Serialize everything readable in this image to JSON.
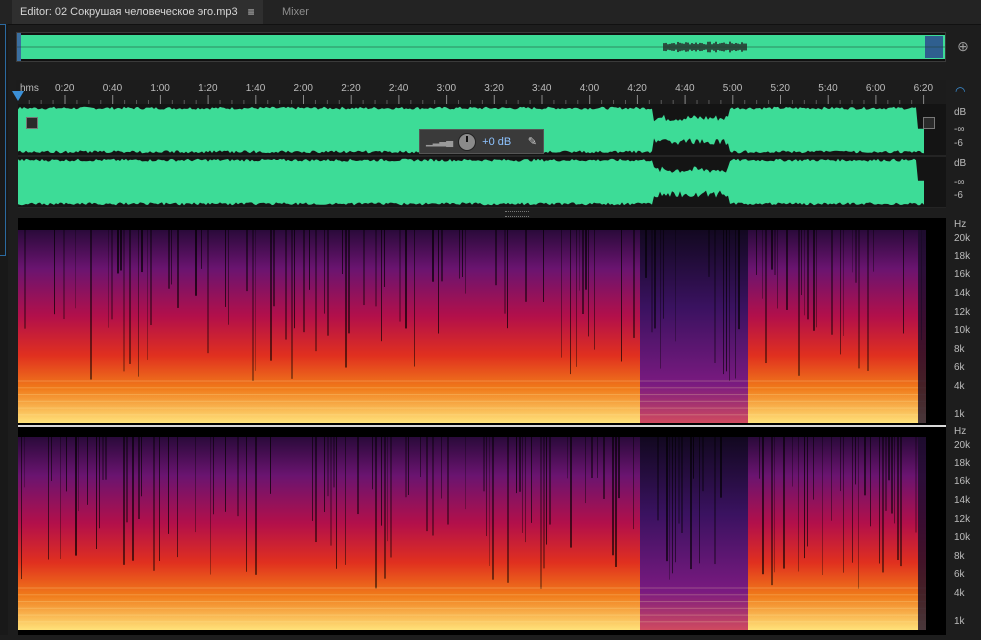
{
  "tabs": {
    "editor": {
      "label": "Editor: 02 Сокрушая человеческое эго.mp3",
      "menu_icon": "hamburger-icon"
    },
    "mixer": {
      "label": "Mixer"
    }
  },
  "timeline": {
    "format_label": "hms",
    "ticks": [
      "0:20",
      "0:40",
      "1:00",
      "1:20",
      "1:40",
      "2:00",
      "2:20",
      "2:40",
      "3:00",
      "3:20",
      "3:40",
      "4:00",
      "4:20",
      "4:40",
      "5:00",
      "5:20",
      "5:40",
      "6:00",
      "6:20"
    ]
  },
  "waveform": {
    "color": "#3ddc97",
    "channels": [
      {
        "scale": [
          "dB",
          "-∞",
          "-6"
        ]
      },
      {
        "scale": [
          "dB",
          "-∞",
          "-6"
        ]
      }
    ]
  },
  "hud": {
    "volume": "+0 dB"
  },
  "spectrogram": {
    "scale_labels": [
      "Hz",
      "20k",
      "18k",
      "16k",
      "14k",
      "12k",
      "10k",
      "8k",
      "6k",
      "4k",
      "1k"
    ]
  },
  "icons": {
    "zoom": "zoom-icon",
    "headphones": "headphones-icon",
    "pin": "pin-icon",
    "playhead": "playhead-icon"
  }
}
